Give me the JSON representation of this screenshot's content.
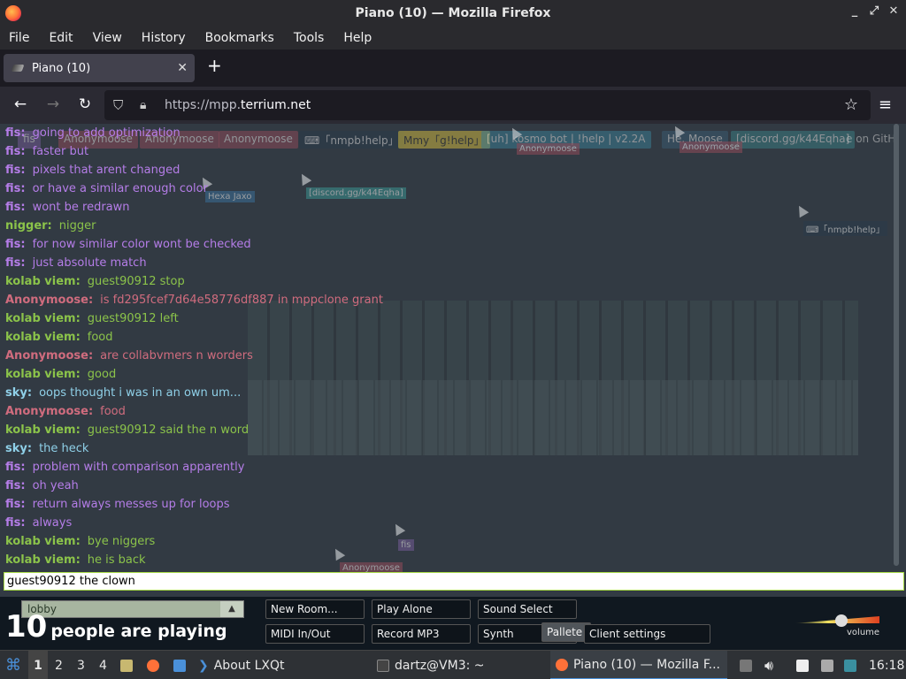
{
  "window": {
    "title": "Piano (10) — Mozilla Firefox",
    "controls": [
      "_",
      "⤢",
      "✕"
    ]
  },
  "menu": [
    "File",
    "Edit",
    "View",
    "History",
    "Bookmarks",
    "Tools",
    "Help"
  ],
  "tab": {
    "label": "Piano (10)",
    "close": "✕",
    "new_tab": "+"
  },
  "nav": {
    "back": "←",
    "forward": "→",
    "reload": "↻",
    "url_prefix": "https://mpp.",
    "url_domain": "terrium.net",
    "star": "☆",
    "menu": "≡"
  },
  "namebars": [
    {
      "text": "fis",
      "color": "#6e5890"
    },
    {
      "text": "Anonymoose",
      "color": "#8a4a58"
    },
    {
      "text": "Anonymoose",
      "color": "#8a4a58"
    },
    {
      "text": "Anonymoose",
      "color": "#8a4a58"
    },
    {
      "text": "⌨「nmpb!help」",
      "color": "#2a3a4a"
    },
    {
      "text": "Mmy「g!help」",
      "color": "#c9b240"
    },
    {
      "text": "[uh] kosmo bot | !help | v2.2A",
      "color": "#3a7a90"
    },
    {
      "text": "He. Moose",
      "color": "#3a5a70"
    },
    {
      "text": "[discord.gg/k44Eqha]",
      "color": "#3a7a80"
    },
    {
      "text": "e on GitH",
      "color": "#5a6a7a"
    }
  ],
  "cursors": [
    {
      "label": "Hexa Jaxo",
      "color": "#3a6a90"
    },
    {
      "label": "[discord.gg/k44Eqha]",
      "color": "#3a8a8a"
    },
    {
      "label": "Anonymoose",
      "color": "#8a4a58"
    },
    {
      "label": "Anonymoose",
      "color": "#8a4a58"
    },
    {
      "label": "⌨「nmpb!help」",
      "color": "#2a3a4a"
    },
    {
      "label": "fis",
      "color": "#6e5890"
    },
    {
      "label": "Anonymoose",
      "color": "#8a4a58"
    }
  ],
  "chat": [
    {
      "who": "fis:",
      "msg": "going to add optimization",
      "color": "#b57de8"
    },
    {
      "who": "fis:",
      "msg": "faster but",
      "color": "#b57de8"
    },
    {
      "who": "fis:",
      "msg": "pixels that arent changed",
      "color": "#b57de8"
    },
    {
      "who": "fis:",
      "msg": "or have a similar enough color",
      "color": "#b57de8"
    },
    {
      "who": "fis:",
      "msg": "wont be redrawn",
      "color": "#b57de8"
    },
    {
      "who": "nigger:",
      "msg": "nigger",
      "color": "#8bc34a"
    },
    {
      "who": "fis:",
      "msg": "for now similar color wont be checked",
      "color": "#b57de8"
    },
    {
      "who": "fis:",
      "msg": "just absolute match",
      "color": "#b57de8"
    },
    {
      "who": "kolab viem:",
      "msg": "guest90912 stop",
      "color": "#8bc34a"
    },
    {
      "who": "Anonymoose:",
      "msg": "is fd295fcef7d64e58776df887 in mppclone grant",
      "color": "#d06c7e"
    },
    {
      "who": "kolab viem:",
      "msg": "guest90912 left",
      "color": "#8bc34a"
    },
    {
      "who": "kolab viem:",
      "msg": "food",
      "color": "#8bc34a"
    },
    {
      "who": "Anonymoose:",
      "msg": "are collabvmers n worders",
      "color": "#d06c7e"
    },
    {
      "who": "kolab viem:",
      "msg": "good",
      "color": "#8bc34a"
    },
    {
      "who": "sky:",
      "msg": "oops thought i was in an own um...",
      "color": "#8fd0e8"
    },
    {
      "who": "Anonymoose:",
      "msg": "food",
      "color": "#d06c7e"
    },
    {
      "who": "kolab viem:",
      "msg": "guest90912 said the n word",
      "color": "#8bc34a"
    },
    {
      "who": "sky:",
      "msg": "the heck",
      "color": "#8fd0e8"
    },
    {
      "who": "fis:",
      "msg": "problem with comparison apparently",
      "color": "#b57de8"
    },
    {
      "who": "fis:",
      "msg": "oh yeah",
      "color": "#b57de8"
    },
    {
      "who": "fis:",
      "msg": "return always messes up for loops",
      "color": "#b57de8"
    },
    {
      "who": "fis:",
      "msg": "always",
      "color": "#b57de8"
    },
    {
      "who": "kolab viem:",
      "msg": "bye niggers",
      "color": "#8bc34a"
    },
    {
      "who": "kolab viem:",
      "msg": "he is back",
      "color": "#8bc34a"
    }
  ],
  "chat_input": {
    "value": "guest90912 the clown"
  },
  "controls": {
    "room": "lobby",
    "room_arrow": "▲",
    "count": "10",
    "count_text": "people are playing",
    "buttons": {
      "new_room": "New Room...",
      "play_alone": "Play Alone",
      "sound_select": "Sound Select",
      "midi": "MIDI In/Out",
      "record": "Record MP3",
      "synth": "Synth",
      "pallete": "Pallete",
      "client_settings": "Client settings"
    },
    "volume_label": "volume"
  },
  "taskbar": {
    "desktops": [
      "1",
      "2",
      "3",
      "4"
    ],
    "about": "About LXQt",
    "terminal": "dartz@VM3: ~",
    "firefox": "Piano (10) — Mozilla F...",
    "clock": "16:18"
  }
}
